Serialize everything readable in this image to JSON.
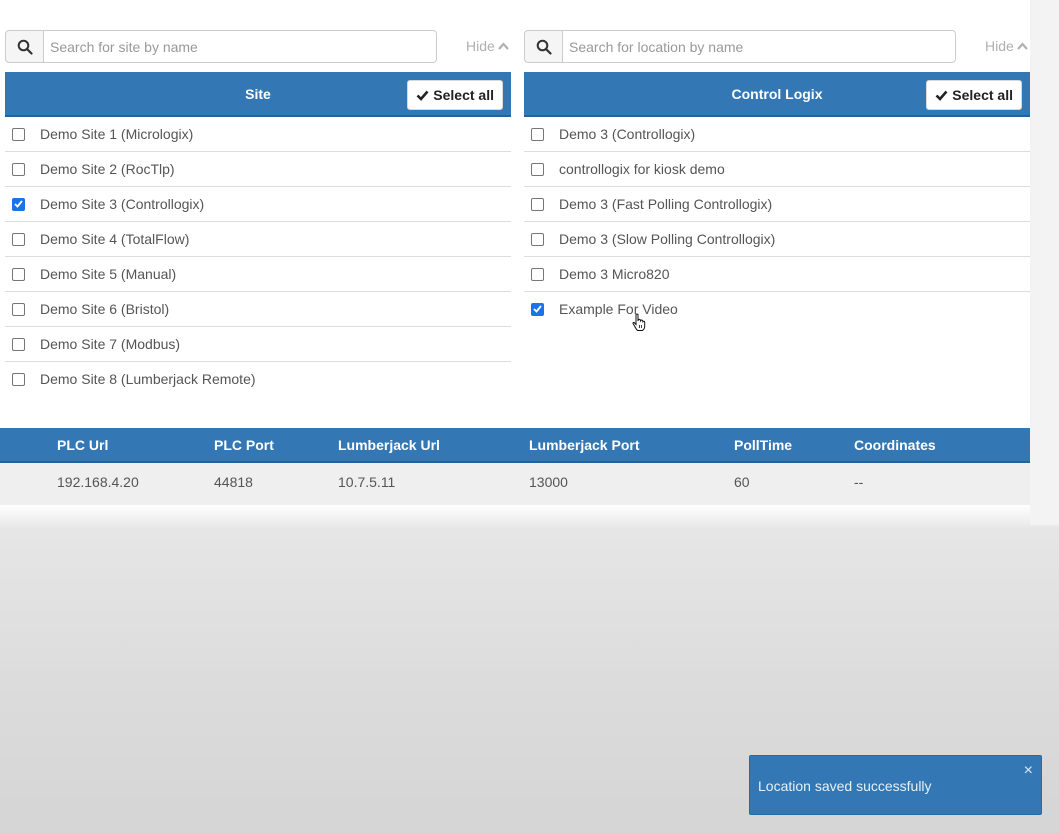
{
  "site_panel": {
    "search_placeholder": "Search for site by name",
    "hide_label": "Hide",
    "header_title": "Site",
    "select_all_label": "Select all",
    "items": [
      {
        "label": "Demo Site 1 (Micrologix)",
        "checked": false
      },
      {
        "label": "Demo Site 2 (RocTlp)",
        "checked": false
      },
      {
        "label": "Demo Site 3 (Controllogix)",
        "checked": true
      },
      {
        "label": "Demo Site 4 (TotalFlow)",
        "checked": false
      },
      {
        "label": "Demo Site 5 (Manual)",
        "checked": false
      },
      {
        "label": "Demo Site 6 (Bristol)",
        "checked": false
      },
      {
        "label": "Demo Site 7 (Modbus)",
        "checked": false
      },
      {
        "label": "Demo Site 8 (Lumberjack Remote)",
        "checked": false
      }
    ]
  },
  "location_panel": {
    "search_placeholder": "Search for location by name",
    "hide_label": "Hide",
    "header_title": "Control Logix",
    "select_all_label": "Select all",
    "items": [
      {
        "label": "Demo 3 (Controllogix)",
        "checked": false
      },
      {
        "label": "controllogix for kiosk demo",
        "checked": false
      },
      {
        "label": "Demo 3 (Fast Polling Controllogix)",
        "checked": false
      },
      {
        "label": "Demo 3 (Slow Polling Controllogix)",
        "checked": false
      },
      {
        "label": "Demo 3 Micro820",
        "checked": false
      },
      {
        "label": "Example For Video",
        "checked": true
      }
    ]
  },
  "details_table": {
    "columns": [
      "PLC Url",
      "PLC Port",
      "Lumberjack Url",
      "Lumberjack Port",
      "PollTime",
      "Coordinates"
    ],
    "row": [
      "192.168.4.20",
      "44818",
      "10.7.5.11",
      "13000",
      "60",
      "--"
    ]
  },
  "toast": {
    "message": "Location saved successfully",
    "close_glyph": "×"
  },
  "colors": {
    "header_blue": "#3378b5",
    "checkbox_blue": "#1a73e8"
  }
}
